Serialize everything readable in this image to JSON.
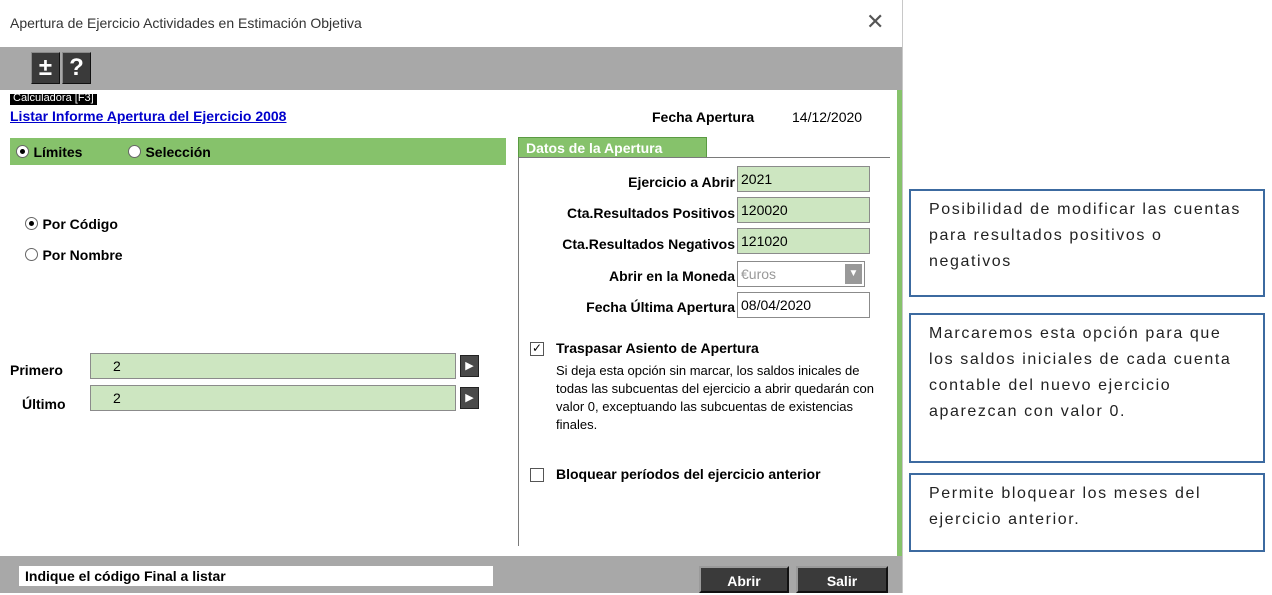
{
  "window": {
    "title": "Apertura de Ejercicio Actividades en Estimación Objetiva",
    "close_glyph": "✕"
  },
  "toolbar": {
    "plusminus": "±",
    "help": "?",
    "tooltip": "Calculadora [F3]"
  },
  "header": {
    "link": "Listar Informe Apertura del Ejercicio 2008",
    "fecha_label": "Fecha Apertura",
    "fecha_value": "14/12/2020"
  },
  "left": {
    "mode_options": [
      "Límites",
      "Selección"
    ],
    "order_options": [
      "Por Código",
      "Por Nombre"
    ],
    "primero_label": "Primero",
    "primero_value": "2",
    "ultimo_label": "Último",
    "ultimo_value": "2"
  },
  "datos": {
    "tab_label": "Datos de la Apertura",
    "ejercicio_label": "Ejercicio a Abrir",
    "ejercicio_value": "2021",
    "positivos_label": "Cta.Resultados Positivos",
    "positivos_value": "120020",
    "negativos_label": "Cta.Resultados Negativos",
    "negativos_value": "121020",
    "moneda_label": "Abrir en la Moneda",
    "moneda_value": "€uros",
    "ultima_label": "Fecha Última Apertura",
    "ultima_value": "08/04/2020",
    "traspasar_label": "Traspasar Asiento de Apertura",
    "traspasar_desc": "Si deja esta opción sin marcar, los saldos inicales de todas las subcuentas del ejercicio a abrir quedarán con valor 0, exceptuando las subcuentas de existencias finales.",
    "bloquear_label": "Bloquear períodos del ejercicio anterior"
  },
  "status": {
    "text": "Indique el código Final a listar",
    "abrir": "Abrir",
    "salir": "Salir"
  },
  "callouts": [
    "Posibilidad de modificar las cuentas para resultados positivos o negativos",
    "Marcaremos esta opción para que los saldos iniciales de cada cuenta contable del nuevo ejercicio aparezcan con valor 0.",
    "Permite bloquear los meses del ejercicio anterior."
  ],
  "colors": {
    "green": "#86c26b",
    "field_green": "#cde6c1",
    "link": "#0000cc",
    "callout_border": "#3c6aa0"
  }
}
